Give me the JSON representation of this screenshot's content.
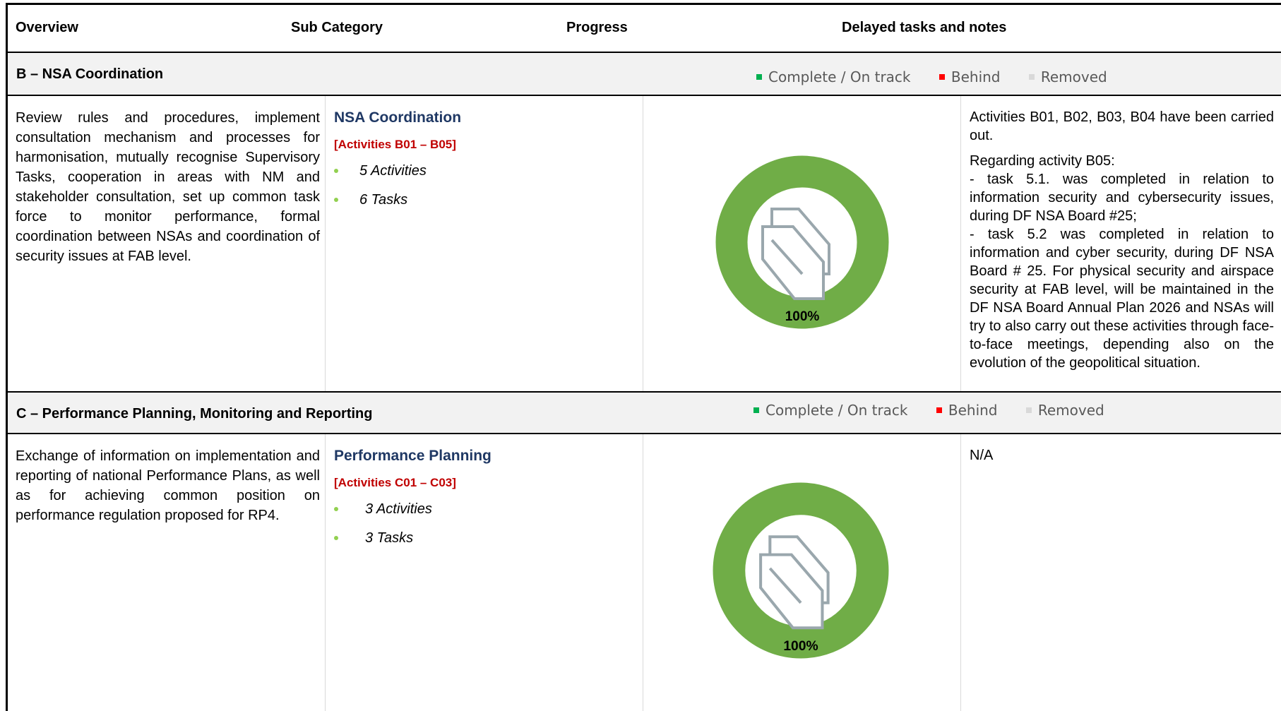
{
  "header": {
    "col_overview": "Overview",
    "col_sub_category": "Sub Category",
    "col_progress": "Progress",
    "col_notes": "Delayed tasks and notes"
  },
  "legend": {
    "complete": "Complete / On track",
    "behind": "Behind",
    "removed": "Removed",
    "colors": {
      "complete": "#00b050",
      "behind": "#ff0000",
      "removed": "#d9d9d9"
    }
  },
  "sections": [
    {
      "title": "B – NSA Coordination",
      "overview": "Review rules and procedures, implement consultation mechanism and processes for harmonisation, mutually recognise Supervisory Tasks, cooperation in areas with NM and stakeholder consultation, set up common task force to monitor performance, formal coordination between NSAs and coordination of security issues at FAB level.",
      "sub_title": "NSA Coordination",
      "activities_range": "[Activities B01 – B05]",
      "bullets": [
        "5 Activities",
        "6 Tasks"
      ],
      "progress_label": "100%",
      "progress_fraction": 1.0,
      "notes": [
        "Activities B01, B02, B03, B04 have been carried out.",
        "Regarding activity B05:",
        "- task 5.1. was completed in relation to information security and cybersecurity issues, during DF NSA Board #25;",
        "- task 5.2 was completed in relation to information and cyber security, during DF NSA Board # 25. For physical security and airspace security at FAB level, will be maintained in the DF NSA Board Annual Plan 2026 and NSAs will try to also carry out these activities through face-to-face meetings, depending also on the evolution of the geopolitical situation."
      ]
    },
    {
      "title": "C – Performance Planning, Monitoring and Reporting",
      "overview": "Exchange of information on implementation and reporting of national Performance Plans, as well as for achieving common position on performance regulation proposed for RP4.",
      "sub_title": "Performance Planning",
      "activities_range": "[Activities C01 – C03]",
      "bullets": [
        "3 Activities",
        "3 Tasks"
      ],
      "progress_label": "100%",
      "progress_fraction": 1.0,
      "notes": [
        "N/A"
      ]
    }
  ],
  "colors": {
    "donut": "#70ad47",
    "logo": "#9aa7ad",
    "sub_title": "#1f3864",
    "activities": "#c00000",
    "bullet": "#92d050"
  }
}
